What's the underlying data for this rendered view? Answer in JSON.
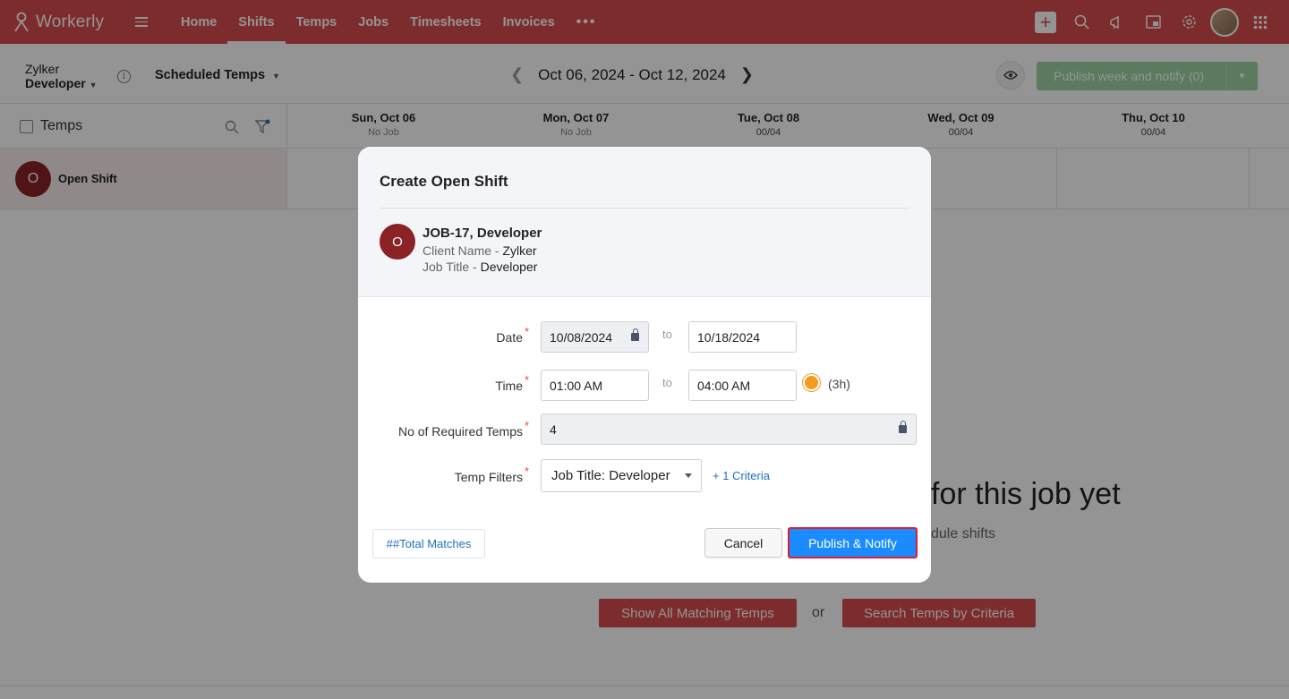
{
  "app": {
    "name": "Workerly"
  },
  "nav": {
    "items": [
      "Home",
      "Shifts",
      "Temps",
      "Jobs",
      "Timesheets",
      "Invoices"
    ],
    "active": "Shifts",
    "more": "•••"
  },
  "subbar": {
    "client_line1": "Zylker",
    "client_line2": "Developer",
    "view_selector": "Scheduled Temps",
    "date_range": "Oct 06, 2024 - Oct 12, 2024",
    "publish_button": "Publish week and notify (0)"
  },
  "grid": {
    "temps_header": "Temps",
    "days": [
      {
        "day": "Sun, Oct 06",
        "sub": "No Job"
      },
      {
        "day": "Mon, Oct 07",
        "sub": "No Job"
      },
      {
        "day": "Tue, Oct 08",
        "sub": "00/04"
      },
      {
        "day": "Wed, Oct 09",
        "sub": "00/04"
      },
      {
        "day": "Thu, Oct 10",
        "sub": "00/04"
      }
    ],
    "open_shift": {
      "initial": "O",
      "label": "Open Shift"
    }
  },
  "empty": {
    "title": "for this job yet",
    "subtitle": "dule shifts",
    "show_all": "Show All Matching Temps",
    "or": "or",
    "search": "Search Temps by Criteria"
  },
  "modal": {
    "title": "Create Open Shift",
    "initial": "O",
    "job": "JOB-17, Developer",
    "client_key": "Client Name",
    "client_value": "Zylker",
    "jobtitle_key": "Job Title",
    "jobtitle_value": "Developer",
    "sep": " - ",
    "date_label": "Date",
    "date_from": "10/08/2024",
    "date_to": "10/18/2024",
    "to": "to",
    "time_label": "Time",
    "time_from": "01:00 AM",
    "time_to": "04:00 AM",
    "duration": "(3h)",
    "req_label": "No of Required Temps",
    "req_value": "4",
    "filters_label": "Temp Filters",
    "filter_value": "Job Title: Developer",
    "criteria_link": "+ 1 Criteria",
    "total_matches": "##Total Matches",
    "cancel": "Cancel",
    "publish": "Publish & Notify",
    "required_mark": "*"
  },
  "colors": {
    "brand": "#d84d4f",
    "primary": "#1a8cff",
    "avatar": "#8b2326",
    "publish_week": "#9dd3a3"
  }
}
